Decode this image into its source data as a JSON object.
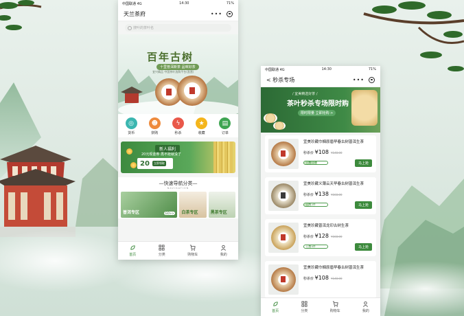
{
  "left_phone": {
    "status": {
      "carrier": "中国联通",
      "network": "4G",
      "time": "14:30",
      "battery": "71%"
    },
    "title": "天兰茶府",
    "search_placeholder": "搜叶的茶叶名",
    "banner": {
      "title": "百年古树",
      "subtitle": "十里普洱新茶 品味好茶",
      "caption": "宜兴精品 中国茶叶选购平台(直营)"
    },
    "icons": [
      {
        "label": "货币",
        "color": "#3bb6b0",
        "icon": "coin-icon"
      },
      {
        "label": "拼购",
        "color": "#ee8a3c",
        "icon": "group-buy-icon"
      },
      {
        "label": "秒杀",
        "color": "#e9584a",
        "icon": "flash-icon"
      },
      {
        "label": "收藏",
        "color": "#f4b51c",
        "icon": "star-icon"
      },
      {
        "label": "订单",
        "color": "#3fa552",
        "icon": "order-icon"
      }
    ],
    "welfare": {
      "tag": "新人福利",
      "message": "20元现金券 再不抢就没了",
      "amount": "20",
      "button": "立即领取"
    },
    "nav": {
      "title": "—快速导航分类—",
      "subtitle": "NAVIGATION",
      "cards": [
        {
          "label": "普洱专区",
          "go": "GO>>"
        },
        {
          "label": "白茶专区"
        },
        {
          "label": "黑茶专区"
        }
      ]
    },
    "tabs": [
      {
        "label": "首页",
        "icon": "leaf-icon"
      },
      {
        "label": "分类",
        "icon": "grid-icon"
      },
      {
        "label": "购物车",
        "icon": "cart-icon"
      },
      {
        "label": "我的",
        "icon": "user-icon"
      }
    ]
  },
  "right_phone": {
    "status": {
      "carrier": "中国联通",
      "network": "4G",
      "time": "14:30",
      "battery": "71%"
    },
    "title": "< 秒杀专场",
    "banner": {
      "line1": "/ 宜美精选好茶 /",
      "line2": "茶叶秒杀专场限时购",
      "button": "限时限量 立即抢购 >"
    },
    "price_label": "秒杀价",
    "buy_label": "马上抢",
    "items": [
      {
        "name": "宜美珍藏巾帼原眉早春古树普洱生茶",
        "price": "¥108",
        "orig": "¥148.00",
        "sold": "已售12件",
        "progress": 0.55
      },
      {
        "name": "宜美珍藏义薄云天早春古树普洱生茶",
        "price": "¥138",
        "orig": "¥168.00",
        "sold": "已售2件",
        "progress": 0.2
      },
      {
        "name": "宜美珍藏普洱龙印古树生茶",
        "price": "¥128",
        "orig": "¥168.00",
        "sold": "已售0件",
        "progress": 0.0
      },
      {
        "name": "宜美珍藏巾帼原眉早春古树普洱生茶",
        "price": "¥108",
        "orig": "¥148.00",
        "sold": "",
        "progress": 0.0
      }
    ],
    "tabs": [
      {
        "label": "首页",
        "icon": "leaf-icon"
      },
      {
        "label": "分类",
        "icon": "grid-icon"
      },
      {
        "label": "购物车",
        "icon": "cart-icon"
      },
      {
        "label": "我的",
        "icon": "user-icon"
      }
    ]
  }
}
